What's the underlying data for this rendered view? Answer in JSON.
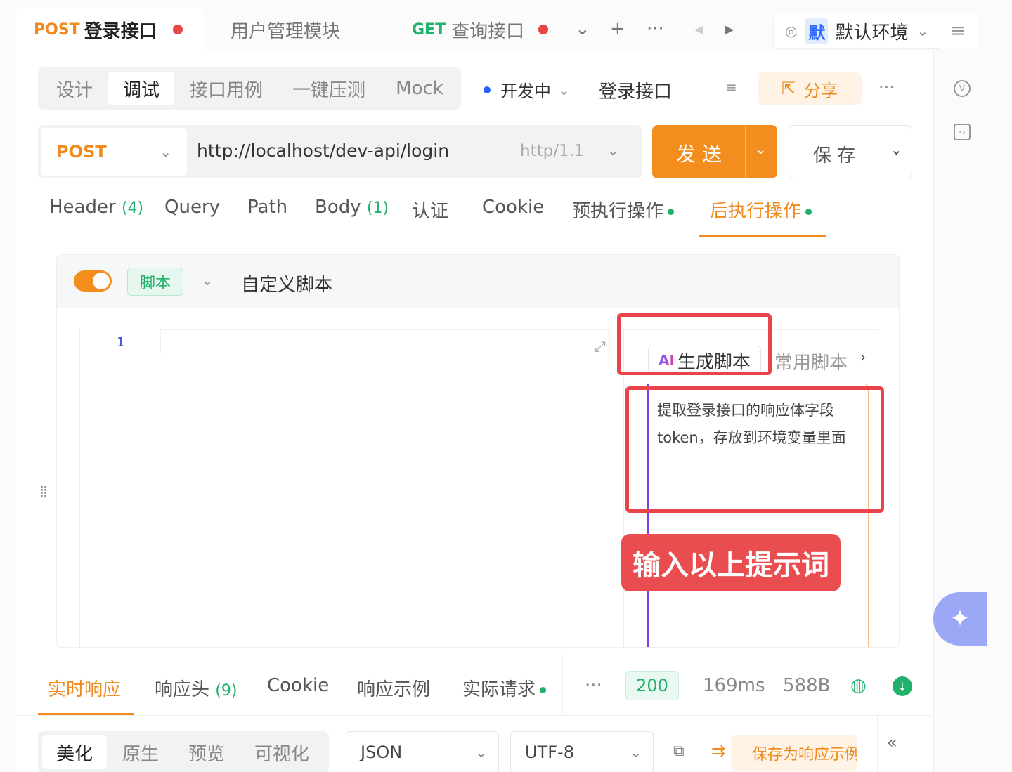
{
  "topTabs": [
    {
      "method": "POST",
      "label": "登录接口"
    },
    {
      "label": "用户管理模块"
    },
    {
      "method": "GET",
      "label": "查询接口"
    }
  ],
  "toolbar": {
    "chevron": "⌄",
    "plus": "+",
    "more": "···",
    "prev": "◀",
    "next": "▶",
    "menu": "≡"
  },
  "environment": {
    "badge": "默",
    "label": "默认环境"
  },
  "modes": [
    "设计",
    "调试",
    "接口用例",
    "一键压测",
    "Mock"
  ],
  "apiStatus": "开发中",
  "apiName": "登录接口",
  "shareLabel": "分享",
  "request": {
    "method": "POST",
    "url": "http://localhost/dev-api/login",
    "protocol": "http/1.1",
    "sendLabel": "发 送",
    "saveLabel": "保 存"
  },
  "requestTabs": {
    "header": "Header",
    "headerCount": "(4)",
    "query": "Query",
    "path": "Path",
    "body": "Body",
    "bodyCount": "(1)",
    "auth": "认证",
    "cookie": "Cookie",
    "pre": "预执行操作",
    "post": "后执行操作"
  },
  "script": {
    "tag": "脚本",
    "name": "自定义脚本",
    "lineNumber": "1",
    "aiTab": "生成脚本",
    "aiLogo": "AI",
    "commonTab": "常用脚本",
    "prompt": "提取登录接口的响应体字段token，存放到环境变量里面"
  },
  "callout": "输入以上提示词",
  "responseTabs": {
    "live": "实时响应",
    "headers": "响应头",
    "headersCount": "(9)",
    "cookie": "Cookie",
    "example": "响应示例",
    "actual": "实际请求",
    "more": "···"
  },
  "responseMeta": {
    "status": "200",
    "time": "169ms",
    "size": "588B"
  },
  "formatTabs": [
    "美化",
    "原生",
    "预览",
    "可视化"
  ],
  "formatSelect": "JSON",
  "encodingSelect": "UTF-8",
  "saveExample": "保存为响应示例",
  "colors": {
    "accent": "#f08a1c",
    "success": "#20b26b",
    "danger": "#e8454a",
    "link": "#2a62ff"
  }
}
